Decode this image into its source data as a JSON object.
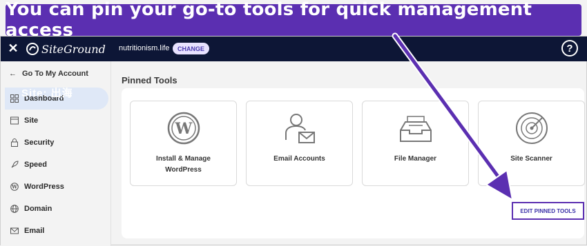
{
  "banner": {
    "text": "You can pin your go-to tools for quick management access"
  },
  "topbar": {
    "close_icon": "close-icon",
    "logo_text": "SiteGround",
    "site_name": "nutritionism.life",
    "change_label": "CHANGE",
    "help_label": "?"
  },
  "sidebar": {
    "back_label": "Go To My Account",
    "glitch_text": "Site: 出海",
    "items": [
      {
        "label": "Dashboard",
        "icon": "grid-icon",
        "active": true
      },
      {
        "label": "Site",
        "icon": "site-icon",
        "active": false
      },
      {
        "label": "Security",
        "icon": "lock-icon",
        "active": false
      },
      {
        "label": "Speed",
        "icon": "rocket-icon",
        "active": false
      },
      {
        "label": "WordPress",
        "icon": "wordpress-icon",
        "active": false
      },
      {
        "label": "Domain",
        "icon": "globe-icon",
        "active": false
      },
      {
        "label": "Email",
        "icon": "mail-icon",
        "active": false
      }
    ]
  },
  "main": {
    "section_title": "Pinned Tools",
    "cards": [
      {
        "label": "Install & Manage WordPress",
        "icon": "wordpress-icon"
      },
      {
        "label": "Email Accounts",
        "icon": "email-accounts-icon"
      },
      {
        "label": "File Manager",
        "icon": "file-manager-icon"
      },
      {
        "label": "Site Scanner",
        "icon": "radar-icon"
      }
    ],
    "edit_label": "EDIT PINNED TOOLS"
  },
  "colors": {
    "brand_purple": "#5b2fb1",
    "topbar_navy": "#0d1636",
    "active_nav": "#dfe8f7"
  }
}
